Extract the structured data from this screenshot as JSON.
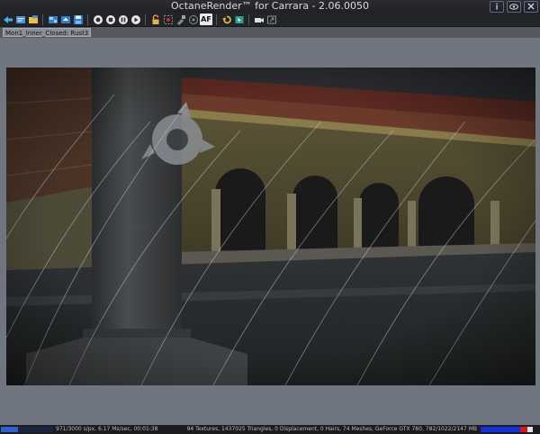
{
  "window": {
    "title": "OctaneRender™ for Carrara - 2.06.0050",
    "controls": [
      "info-icon",
      "view-icon",
      "close-icon"
    ]
  },
  "toolbar": {
    "icons": [
      "send-scene-icon",
      "open-icon",
      "folder-icon",
      "settings-icon",
      "load-icon",
      "save-icon",
      "record-icon",
      "stop-icon",
      "pause-icon",
      "start-icon",
      "lock-icon",
      "region-icon",
      "material-picker-icon",
      "focus-picker-icon",
      "autofocus-icon",
      "undo-icon",
      "cursor-icon",
      "camera-icon",
      "export-icon"
    ],
    "autofocus_label": "AF"
  },
  "tab": {
    "label": "Mon1_Inner_Closed: Rust3"
  },
  "status": {
    "progress": 0.324,
    "left_text": "971/3000 s/px, 6.17 Ms/sec, 00:01:38",
    "right_text": "94 Textures, 1437025 Triangles, 0 Displacement, 0 Hairs, 74 Meshes, GeForce GTX 780, 782/1022/2147 MB",
    "memory_used_fraction": 0.764,
    "memory_reserved_fraction": 0.129
  }
}
